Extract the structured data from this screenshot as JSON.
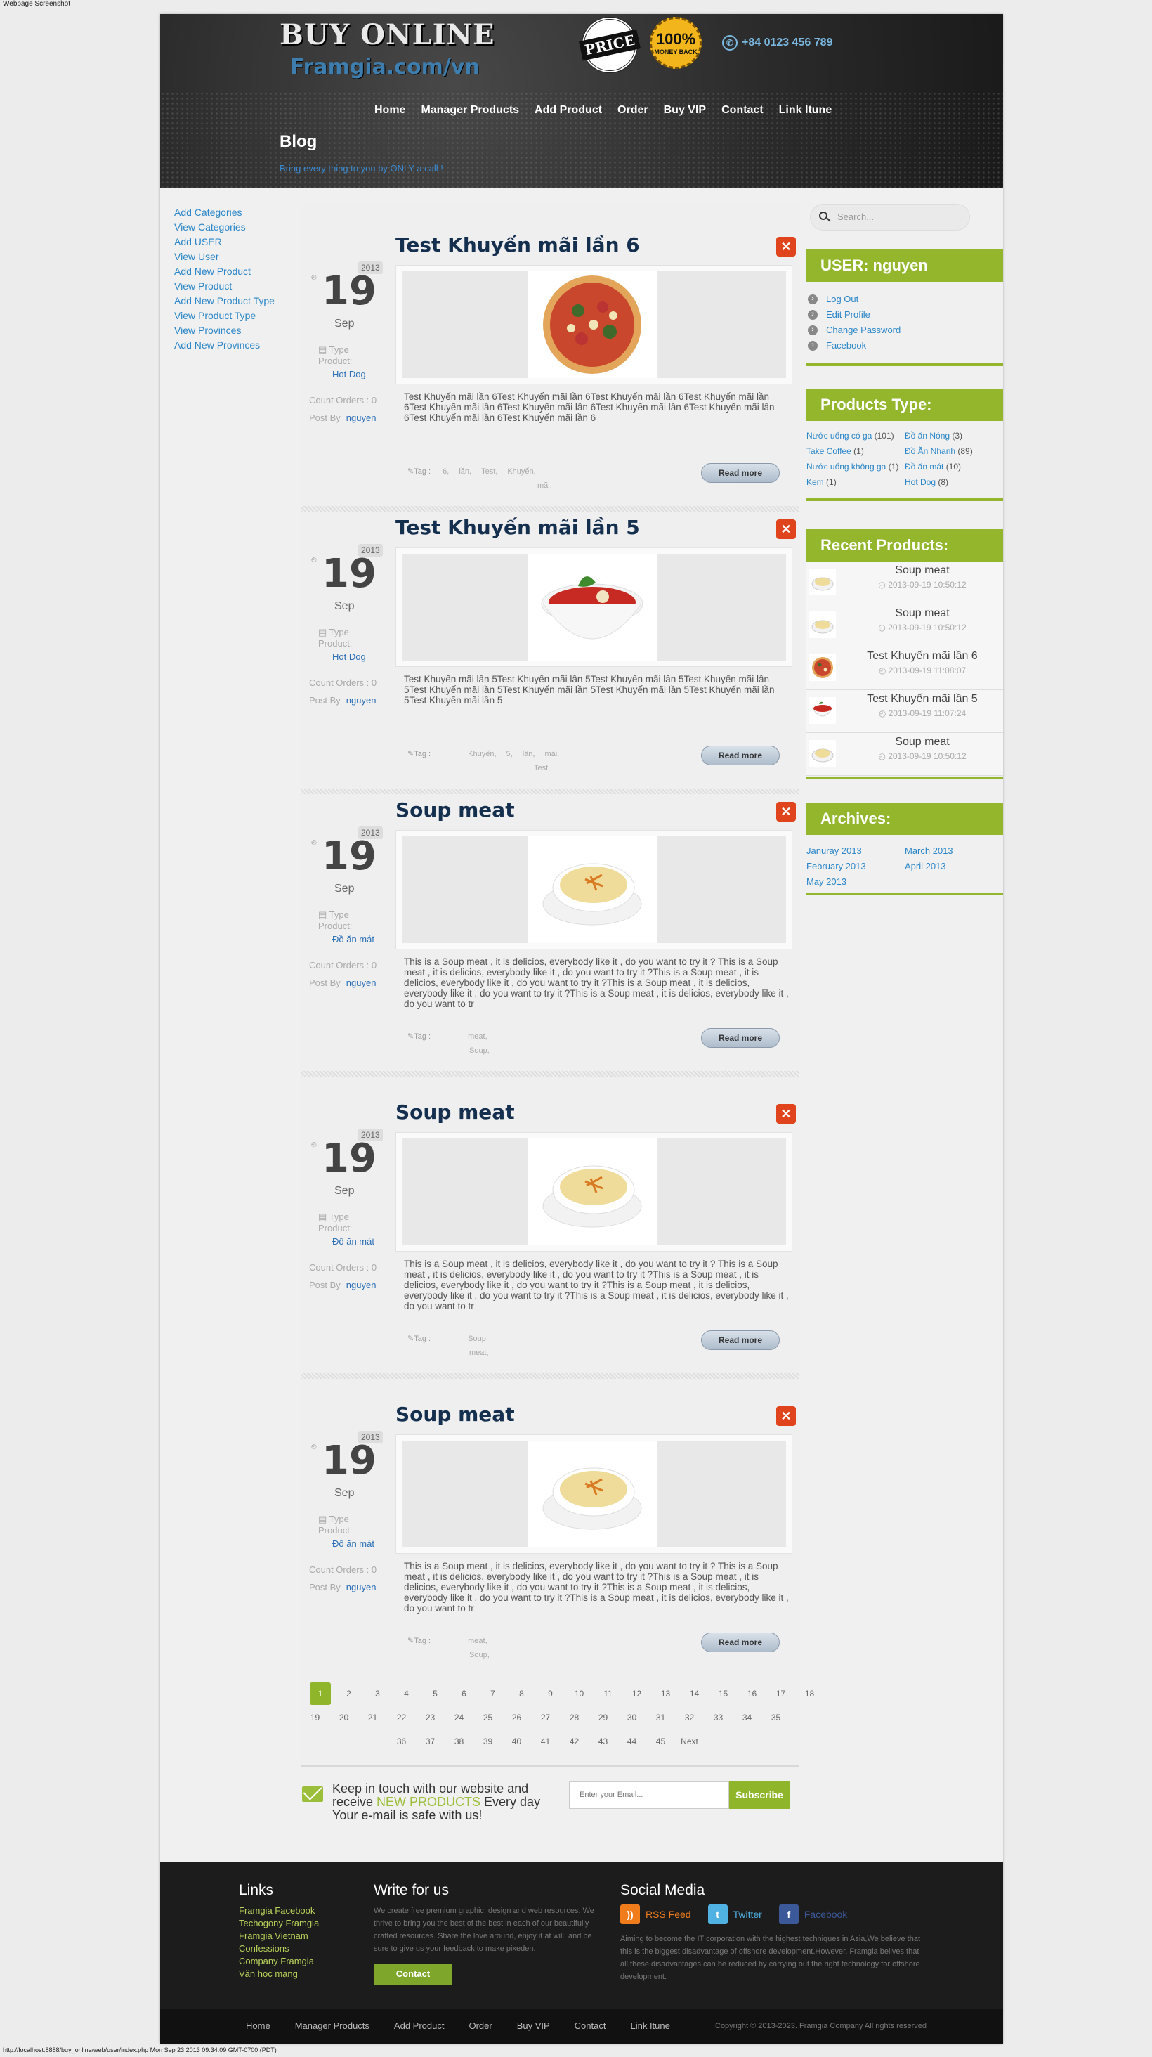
{
  "capture": {
    "title": "Webpage Screenshot",
    "footer_url": "http://localhost:8888/buy_online/web/user/index.php Mon Sep 23 2013 09:34:09 GMT-0700 (PDT)"
  },
  "header": {
    "logo_main": "BUY ONLINE",
    "logo_sub": "Framgia.com/vn",
    "badge_price": "PRICE",
    "badge_money": "100%",
    "badge_money_sub": "MONEY BACK",
    "phone": "+84 0123 456 789",
    "nav": [
      "Home",
      "Manager Products",
      "Add Product",
      "Order",
      "Buy VIP",
      "Contact",
      "Link Itune"
    ],
    "page_title": "Blog",
    "page_subtitle": "Bring every thing to you by ONLY a call !"
  },
  "left_links": [
    "Add Categories",
    "View Categories",
    "Add USER",
    "View User",
    "Add New Product",
    "View Product",
    "Add New Product Type",
    "View Product Type",
    "View Provinces",
    "Add New Provinces"
  ],
  "posts": [
    {
      "title": "Test Khuyến mãi lần 6",
      "year": "2013",
      "day": "19",
      "month": "Sep",
      "type_label": "Type Product:",
      "type_value": "Hot Dog",
      "count": "Count Orders : 0",
      "post_by": "Post By",
      "author": "nguyen",
      "excerpt": "Test Khuyến mãi lần 6Test Khuyến mãi lần 6Test Khuyến mãi lần 6Test Khuyến mãi lần 6Test Khuyến mãi lần 6Test Khuyến mãi lần 6Test Khuyến mãi lần 6Test Khuyến mãi lần 6Test Khuyến mãi lần 6Test Khuyến mãi lần 6",
      "tag_label": "Tag :",
      "tags": [
        "6,",
        "lần,",
        "Test,",
        "Khuyến,",
        "mãi,"
      ],
      "read_more": "Read more",
      "image": "pizza"
    },
    {
      "title": "Test Khuyến mãi lần 5",
      "year": "2013",
      "day": "19",
      "month": "Sep",
      "type_label": "Type Product:",
      "type_value": "Hot Dog",
      "count": "Count Orders : 0",
      "post_by": "Post By",
      "author": "nguyen",
      "excerpt": "Test Khuyến mãi lần 5Test Khuyến mãi lần 5Test Khuyến mãi lần 5Test Khuyến mãi lần 5Test Khuyến mãi lần 5Test Khuyến mãi lần 5Test Khuyến mãi lần 5Test Khuyến mãi lần 5Test Khuyến mãi lần 5",
      "tag_label": "Tag :",
      "tags": [
        "Khuyến,",
        "5,",
        "lần,",
        "mãi,",
        "Test,"
      ],
      "read_more": "Read more",
      "image": "tomato-soup"
    },
    {
      "title": "Soup meat",
      "year": "2013",
      "day": "19",
      "month": "Sep",
      "type_label": "Type Product:",
      "type_value": "Đồ ăn mát",
      "count": "Count Orders : 0",
      "post_by": "Post By",
      "author": "nguyen",
      "excerpt": "This is a Soup meat , it is delicios, everybody like it , do you want to try it ? This is a Soup meat , it is delicios, everybody like it , do you want to try it ?This is a Soup meat , it is delicios, everybody like it , do you want to try it ?This is a Soup meat , it is delicios, everybody like it , do you want to try it ?This is a Soup meat , it is delicios, everybody like it , do you want to tr",
      "tag_label": "Tag :",
      "tags": [
        "meat,",
        "Soup,"
      ],
      "read_more": "Read more",
      "image": "cream-soup"
    },
    {
      "title": "Soup meat",
      "year": "2013",
      "day": "19",
      "month": "Sep",
      "type_label": "Type Product:",
      "type_value": "Đồ ăn mát",
      "count": "Count Orders : 0",
      "post_by": "Post By",
      "author": "nguyen",
      "excerpt": "This is a Soup meat , it is delicios, everybody like it , do you want to try it ? This is a Soup meat , it is delicios, everybody like it , do you want to try it ?This is a Soup meat , it is delicios, everybody like it , do you want to try it ?This is a Soup meat , it is delicios, everybody like it , do you want to try it ?This is a Soup meat , it is delicios, everybody like it , do you want to tr",
      "tag_label": "Tag :",
      "tags": [
        "Soup,",
        "meat,"
      ],
      "read_more": "Read more",
      "image": "cream-soup"
    },
    {
      "title": "Soup meat",
      "year": "2013",
      "day": "19",
      "month": "Sep",
      "type_label": "Type Product:",
      "type_value": "Đồ ăn mát",
      "count": "Count Orders : 0",
      "post_by": "Post By",
      "author": "nguyen",
      "excerpt": "This is a Soup meat , it is delicios, everybody like it , do you want to try it ? This is a Soup meat , it is delicios, everybody like it , do you want to try it ?This is a Soup meat , it is delicios, everybody like it , do you want to try it ?This is a Soup meat , it is delicios, everybody like it , do you want to try it ?This is a Soup meat , it is delicios, everybody like it , do you want to tr",
      "tag_label": "Tag :",
      "tags": [
        "meat,",
        "Soup,"
      ],
      "read_more": "Read more",
      "image": "cream-soup"
    }
  ],
  "pagination": {
    "row1": [
      "1",
      "2",
      "3",
      "4",
      "5",
      "6",
      "7",
      "8",
      "9",
      "10",
      "11",
      "12",
      "13",
      "14",
      "15",
      "16",
      "17",
      "18"
    ],
    "row2": [
      "19",
      "20",
      "21",
      "22",
      "23",
      "24",
      "25",
      "26",
      "27",
      "28",
      "29",
      "30",
      "31",
      "32",
      "33",
      "34",
      "35"
    ],
    "row3": [
      "36",
      "37",
      "38",
      "39",
      "40",
      "41",
      "42",
      "43",
      "44",
      "45",
      "Next"
    ],
    "active": "1"
  },
  "newsletter": {
    "text_before": "Keep in touch with our website and receive ",
    "highlight": "NEW PRODUCTS",
    "text_after": " Every day Your e-mail is safe with us!",
    "placeholder": "Enter your Email...",
    "button": "Subscribe"
  },
  "sidebar": {
    "search_placeholder": "Search...",
    "user_title": "USER: nguyen",
    "user_links": [
      "Log Out",
      "Edit Profile",
      "Change Password",
      "Facebook"
    ],
    "types_title": "Products Type:",
    "types": [
      {
        "name": "Nước uống có ga",
        "count": "(101)"
      },
      {
        "name": "Đồ ăn Nóng",
        "count": "(3)"
      },
      {
        "name": "Take Coffee",
        "count": "(1)"
      },
      {
        "name": "Đồ Ăn Nhanh",
        "count": "(89)"
      },
      {
        "name": "Nước uống không ga",
        "count": "(1)"
      },
      {
        "name": "Đồ ăn mát",
        "count": "(10)"
      },
      {
        "name": "Kem",
        "count": "(1)"
      },
      {
        "name": "Hot Dog",
        "count": "(8)"
      }
    ],
    "recent_title": "Recent Products:",
    "recent": [
      {
        "name": "Soup meat",
        "date": "2013-09-19 10:50:12",
        "image": "cream-soup"
      },
      {
        "name": "Soup meat",
        "date": "2013-09-19 10:50:12",
        "image": "cream-soup"
      },
      {
        "name": "Test Khuyến mãi lần 6",
        "date": "2013-09-19 11:08:07",
        "image": "pizza"
      },
      {
        "name": "Test Khuyến mãi lần 5",
        "date": "2013-09-19 11:07:24",
        "image": "tomato-soup"
      },
      {
        "name": "Soup meat",
        "date": "2013-09-19 10:50:12",
        "image": "cream-soup"
      }
    ],
    "archives_title": "Archives:",
    "archives": [
      "Januray 2013",
      "March 2013",
      "February 2013",
      "April 2013",
      "May 2013"
    ]
  },
  "footer": {
    "links_title": "Links",
    "links": [
      "Framgia Facebook",
      "Techogony Framgia",
      "Framgia Vietnam",
      "Confessions",
      "Company Framgia",
      "Văn học mạng"
    ],
    "write_title": "Write for us",
    "write_text": "We create free premium graphic, design and web resources. We thrive to bring you the best of the best in each of our beautifully crafted resources. Share the love around, enjoy it at will, and be sure to give us your feedback to make pixeden.",
    "contact_button": "Contact",
    "social_title": "Social Media",
    "social": [
      {
        "label": "RSS Feed",
        "icon": "rss-icon",
        "color": "#f07c1b",
        "glyph": "))"
      },
      {
        "label": "Twitter",
        "icon": "twitter-icon",
        "color": "#4fb2e3",
        "glyph": "t"
      },
      {
        "label": "Facebook",
        "icon": "facebook-icon",
        "color": "#3b5998",
        "glyph": "f"
      }
    ],
    "social_text": "Aiming to become the IT corporation with the highest techniques in Asia,We believe that this is the biggest disadvantage of offshore development.However, Framgia belives that all these disadvantages can be reduced by carrying out the right technology for offshore development.",
    "bottom_nav": [
      "Home",
      "Manager Products",
      "Add Product",
      "Order",
      "Buy VIP",
      "Contact",
      "Link Itune"
    ],
    "copyright": "Copyright © 2013-2023. Framgia Company All rights reserved"
  }
}
